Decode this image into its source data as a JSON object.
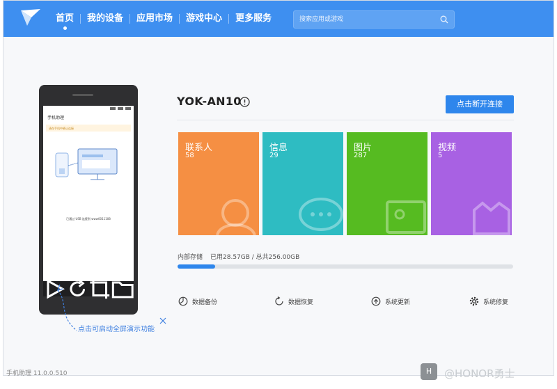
{
  "nav": {
    "items": [
      {
        "label": "首页",
        "active": true
      },
      {
        "label": "我的设备"
      },
      {
        "label": "应用市场"
      },
      {
        "label": "游戏中心"
      },
      {
        "label": "更多服务"
      }
    ]
  },
  "search": {
    "placeholder": "搜索应用或游戏"
  },
  "phone_screen": {
    "title": "手机助理",
    "warning": "请在手机中确认连接",
    "status_text": "已通过 USB 连接到 www0011108"
  },
  "hint": {
    "text": "点击可启动全屏演示功能"
  },
  "device": {
    "name": "YOK-AN10",
    "disconnect_label": "点击断开连接"
  },
  "tiles": [
    {
      "name": "联系人",
      "count": "58",
      "color": "#f58f43"
    },
    {
      "name": "信息",
      "count": "29",
      "color": "#2ebcc2"
    },
    {
      "name": "图片",
      "count": "287",
      "color": "#56bb21"
    },
    {
      "name": "视频",
      "count": "5",
      "color": "#a861e3"
    }
  ],
  "storage": {
    "label": "内部存储",
    "used_text": "已用28.57GB / 总共256.00GB",
    "used_fraction": 0.1116
  },
  "actions": [
    {
      "label": "数据备份",
      "icon": "backup-icon"
    },
    {
      "label": "数据恢复",
      "icon": "restore-icon"
    },
    {
      "label": "系统更新",
      "icon": "update-icon"
    },
    {
      "label": "系统修复",
      "icon": "repair-gear-icon"
    }
  ],
  "footer": {
    "version": "手机助理 11.0.0.510"
  },
  "watermark": {
    "badge": "H",
    "text": "@HONOR勇士"
  },
  "colors": {
    "topbar": "#3e8ff0",
    "accent": "#2e86ec"
  }
}
